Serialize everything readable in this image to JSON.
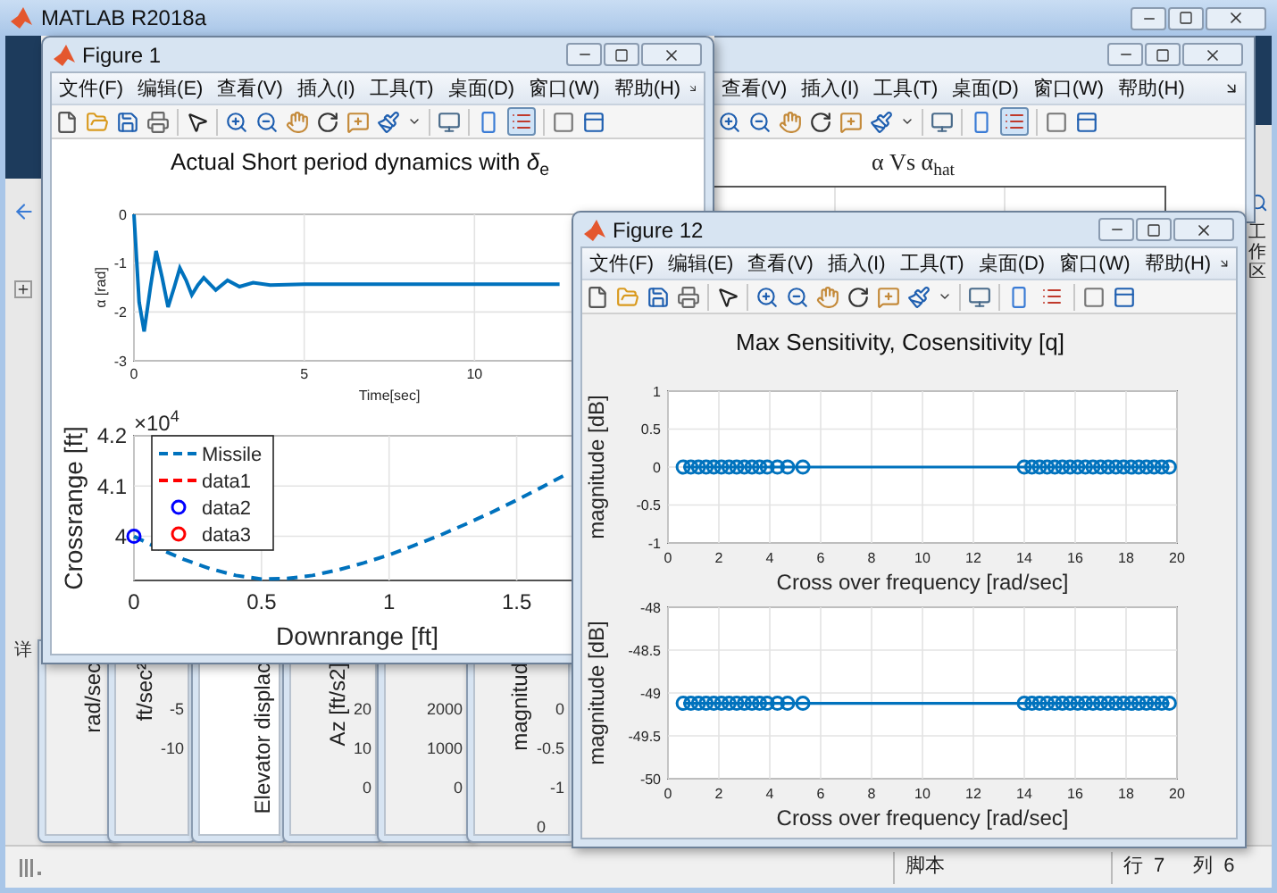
{
  "window": {
    "title": "MATLAB R2018a"
  },
  "left_panel": {
    "label": "详"
  },
  "right_panel": {
    "tab": "工作区"
  },
  "back_figure": {
    "menu": [
      "查看(V)",
      "插入(I)",
      "工具(T)",
      "桌面(D)",
      "窗口(W)",
      "帮助(H)"
    ],
    "legend_button_pressed": true,
    "plot_title": "α Vs α$_{hat}$"
  },
  "figure_1": {
    "title": "Figure 1",
    "menu": [
      "文件(F)",
      "编辑(E)",
      "查看(V)",
      "插入(I)",
      "工具(T)",
      "桌面(D)",
      "窗口(W)",
      "帮助(H)"
    ],
    "legend_button_pressed": true,
    "plots": [
      {
        "title": "Actual Short period dynamics with *δ*$_{e}$",
        "chart_data": {
          "type": "line",
          "xlabel": "Time[sec]",
          "ylabel": "α [rad]",
          "grid": true,
          "x": [
            0,
            0.15,
            0.3,
            0.48,
            0.65,
            0.83,
            1.0,
            1.18,
            1.35,
            1.53,
            1.7,
            1.88,
            2.05,
            2.4,
            2.75,
            3.1,
            3.5,
            4,
            5,
            8,
            12.5
          ],
          "series": [
            {
              "color": "#0072bd",
              "line_style": "solid",
              "values": [
                0,
                -1.8,
                -2.4,
                -1.5,
                -0.75,
                -1.3,
                -1.9,
                -1.5,
                -1.1,
                -1.35,
                -1.65,
                -1.45,
                -1.3,
                -1.55,
                -1.35,
                -1.48,
                -1.4,
                -1.45,
                -1.43,
                -1.43,
                -1.43
              ]
            }
          ],
          "xlim": [
            0,
            15
          ],
          "ylim": [
            -3,
            0
          ],
          "xticks": [
            0,
            5,
            10
          ],
          "yticks": [
            -3,
            -2,
            -1,
            0
          ]
        }
      },
      {
        "exponent": {
          "base": "×10",
          "power": "4"
        },
        "chart_data": {
          "type": "line",
          "xlabel": "Downrange [ft]",
          "ylabel": "Crossrange [ft]",
          "grid": true,
          "legend": "upper left",
          "x": [
            0,
            0.1,
            0.2,
            0.3,
            0.4,
            0.5,
            0.6,
            0.7,
            0.8,
            0.9,
            1.0,
            1.1,
            1.2,
            1.3,
            1.4,
            1.5,
            1.6,
            1.7
          ],
          "series": [
            {
              "name": "Missile",
              "color": "#0072bd",
              "line_style": "dashed",
              "values": [
                4.0,
                3.975,
                3.953,
                3.935,
                3.922,
                3.915,
                3.916,
                3.922,
                3.933,
                3.947,
                3.963,
                3.982,
                4.002,
                4.024,
                4.047,
                4.072,
                4.098,
                4.125
              ]
            },
            {
              "name": "data1",
              "color": "#ff0000",
              "line_style": "dashed",
              "values": [
                null,
                null,
                null,
                null,
                null,
                null,
                null,
                null,
                null,
                null,
                null,
                null,
                null,
                null,
                null,
                null,
                null,
                null
              ]
            },
            {
              "name": "data2",
              "color": "#0000ff",
              "line_style": "none",
              "marker": "o",
              "values": [
                4.0,
                null,
                null,
                null,
                null,
                null,
                null,
                null,
                null,
                null,
                null,
                null,
                null,
                null,
                null,
                null,
                null,
                null
              ]
            },
            {
              "name": "data3",
              "color": "#ff0000",
              "line_style": "none",
              "marker": "o",
              "values": [
                null,
                null,
                null,
                null,
                null,
                null,
                null,
                null,
                null,
                null,
                null,
                null,
                null,
                null,
                null,
                null,
                null,
                null
              ]
            }
          ],
          "xlim": [
            0,
            1.75
          ],
          "ylim": [
            3.912,
            4.2
          ],
          "xticks": [
            0,
            0.5,
            1,
            1.5
          ],
          "yticks": [
            {
              "value": 4,
              "label": "4"
            },
            4.1,
            4.2
          ]
        }
      }
    ]
  },
  "background_figures": [
    {
      "ylabel": "rad/sec"
    },
    {
      "ylabel": "ft/sec²",
      "ticks": [
        "-5",
        "-10"
      ]
    },
    {
      "ylabel": "Elevator displac"
    },
    {
      "ylabel": "Az [ft/s2]",
      "ticks": [
        "20",
        "10",
        "0"
      ]
    },
    {
      "ticks": [
        "2000",
        "1000",
        "0"
      ]
    },
    {
      "ylabel": "magnitud",
      "ticks": [
        "0",
        "-0.5",
        "-1"
      ],
      "xtick": "0"
    }
  ],
  "figure_12": {
    "title": "Figure 12",
    "menu": [
      "文件(F)",
      "编辑(E)",
      "查看(V)",
      "插入(I)",
      "工具(T)",
      "桌面(D)",
      "窗口(W)",
      "帮助(H)"
    ],
    "legend_button_pressed": false,
    "plot_title": "Max Sensitivity, Cosensitivity [q]",
    "plots": [
      {
        "chart_data": {
          "type": "line",
          "xlabel": "Cross over frequency [rad/sec]",
          "ylabel": "magnitude [dB]",
          "grid": true,
          "x": [
            0.6,
            0.9,
            1.2,
            1.5,
            1.8,
            2.1,
            2.4,
            2.7,
            3,
            3.3,
            3.6,
            3.9,
            4.3,
            4.7,
            5.3,
            14,
            14.3,
            14.6,
            14.9,
            15.2,
            15.5,
            15.8,
            16.1,
            16.4,
            16.7,
            17,
            17.3,
            17.6,
            17.9,
            18.2,
            18.5,
            18.8,
            19.1,
            19.4,
            19.7
          ],
          "series": [
            {
              "color": "#0072bd",
              "line_style": "solid",
              "marker": "o",
              "values": [
                0,
                0,
                0,
                0,
                0,
                0,
                0,
                0,
                0,
                0,
                0,
                0,
                0,
                0,
                0,
                0,
                0,
                0,
                0,
                0,
                0,
                0,
                0,
                0,
                0,
                0,
                0,
                0,
                0,
                0,
                0,
                0,
                0,
                0,
                0
              ]
            }
          ],
          "xlim": [
            0,
            20
          ],
          "ylim": [
            -1,
            1
          ],
          "xticks": [
            0,
            2,
            4,
            6,
            8,
            10,
            12,
            14,
            16,
            18,
            20
          ],
          "yticks": [
            -1,
            -0.5,
            0,
            0.5,
            1
          ]
        }
      },
      {
        "chart_data": {
          "type": "line",
          "xlabel": "Cross over frequency [rad/sec]",
          "ylabel": "magnitude [dB]",
          "grid": true,
          "x": [
            0.6,
            0.9,
            1.2,
            1.5,
            1.8,
            2.1,
            2.4,
            2.7,
            3,
            3.3,
            3.6,
            3.9,
            4.3,
            4.7,
            5.3,
            14,
            14.3,
            14.6,
            14.9,
            15.2,
            15.5,
            15.8,
            16.1,
            16.4,
            16.7,
            17,
            17.3,
            17.6,
            17.9,
            18.2,
            18.5,
            18.8,
            19.1,
            19.4,
            19.7
          ],
          "series": [
            {
              "color": "#0072bd",
              "line_style": "solid",
              "marker": "o",
              "values": [
                -49.12,
                -49.12,
                -49.12,
                -49.12,
                -49.12,
                -49.12,
                -49.12,
                -49.12,
                -49.12,
                -49.12,
                -49.12,
                -49.12,
                -49.12,
                -49.12,
                -49.12,
                -49.12,
                -49.12,
                -49.12,
                -49.12,
                -49.12,
                -49.12,
                -49.12,
                -49.12,
                -49.12,
                -49.12,
                -49.12,
                -49.12,
                -49.12,
                -49.12,
                -49.12,
                -49.12,
                -49.12,
                -49.12,
                -49.12,
                -49.12
              ]
            }
          ],
          "xlim": [
            0,
            20
          ],
          "ylim": [
            -50,
            -48
          ],
          "xticks": [
            0,
            2,
            4,
            6,
            8,
            10,
            12,
            14,
            16,
            18,
            20
          ],
          "yticks": [
            -50,
            -49.5,
            -49,
            -48.5,
            -48
          ]
        }
      }
    ]
  },
  "status_bar": {
    "mode": "脚本",
    "row_label": "行",
    "row": "7",
    "col_label": "列",
    "col": "6"
  }
}
